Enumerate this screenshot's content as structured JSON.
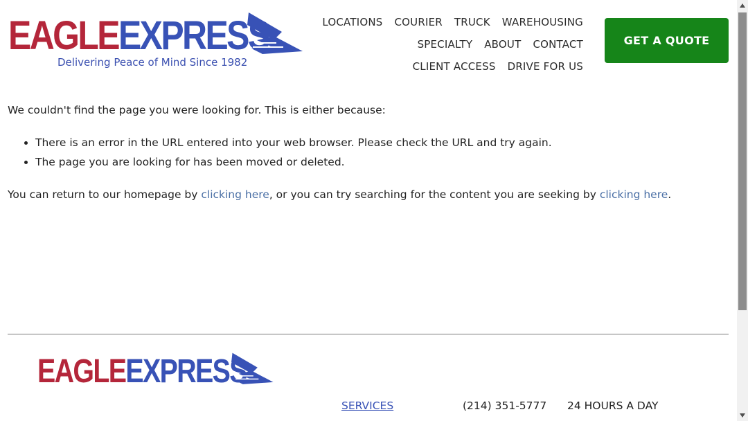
{
  "brand": {
    "logo_red": "EAGLE",
    "logo_blue": "EXPRESS",
    "tagline": "Delivering Peace of Mind Since 1982",
    "red": "#b4263a",
    "blue": "#3852b6"
  },
  "nav": {
    "row1": [
      "LOCATIONS",
      "COURIER",
      "TRUCK",
      "WAREHOUSING"
    ],
    "row2": [
      "SPECIALTY",
      "ABOUT",
      "CONTACT"
    ],
    "row3": [
      "CLIENT ACCESS",
      "DRIVE FOR US"
    ]
  },
  "cta": {
    "label": "GET A QUOTE",
    "color": "#168519"
  },
  "content": {
    "intro": "We couldn't find the page you were looking for. This is either because:",
    "reasons": [
      "There is an error in the URL entered into your web browser. Please check the URL and try again.",
      "The page you are looking for has been moved or deleted."
    ],
    "return_prefix": "You can return to our homepage by ",
    "link1": "clicking here",
    "return_middle": ", or you can try searching for the content you are seeking by ",
    "link2": "clicking here",
    "return_suffix": "."
  },
  "footer": {
    "logo_red": "EAGLE",
    "logo_blue": "EXPRESS",
    "services_label": "SERVICES",
    "phone": "(214) 351-5777",
    "hours": "24 HOURS A DAY"
  },
  "icons": {
    "logo_mark": "eagle-icon",
    "scroll_up": "arrow-up-icon",
    "scroll_down": "arrow-down-icon"
  }
}
